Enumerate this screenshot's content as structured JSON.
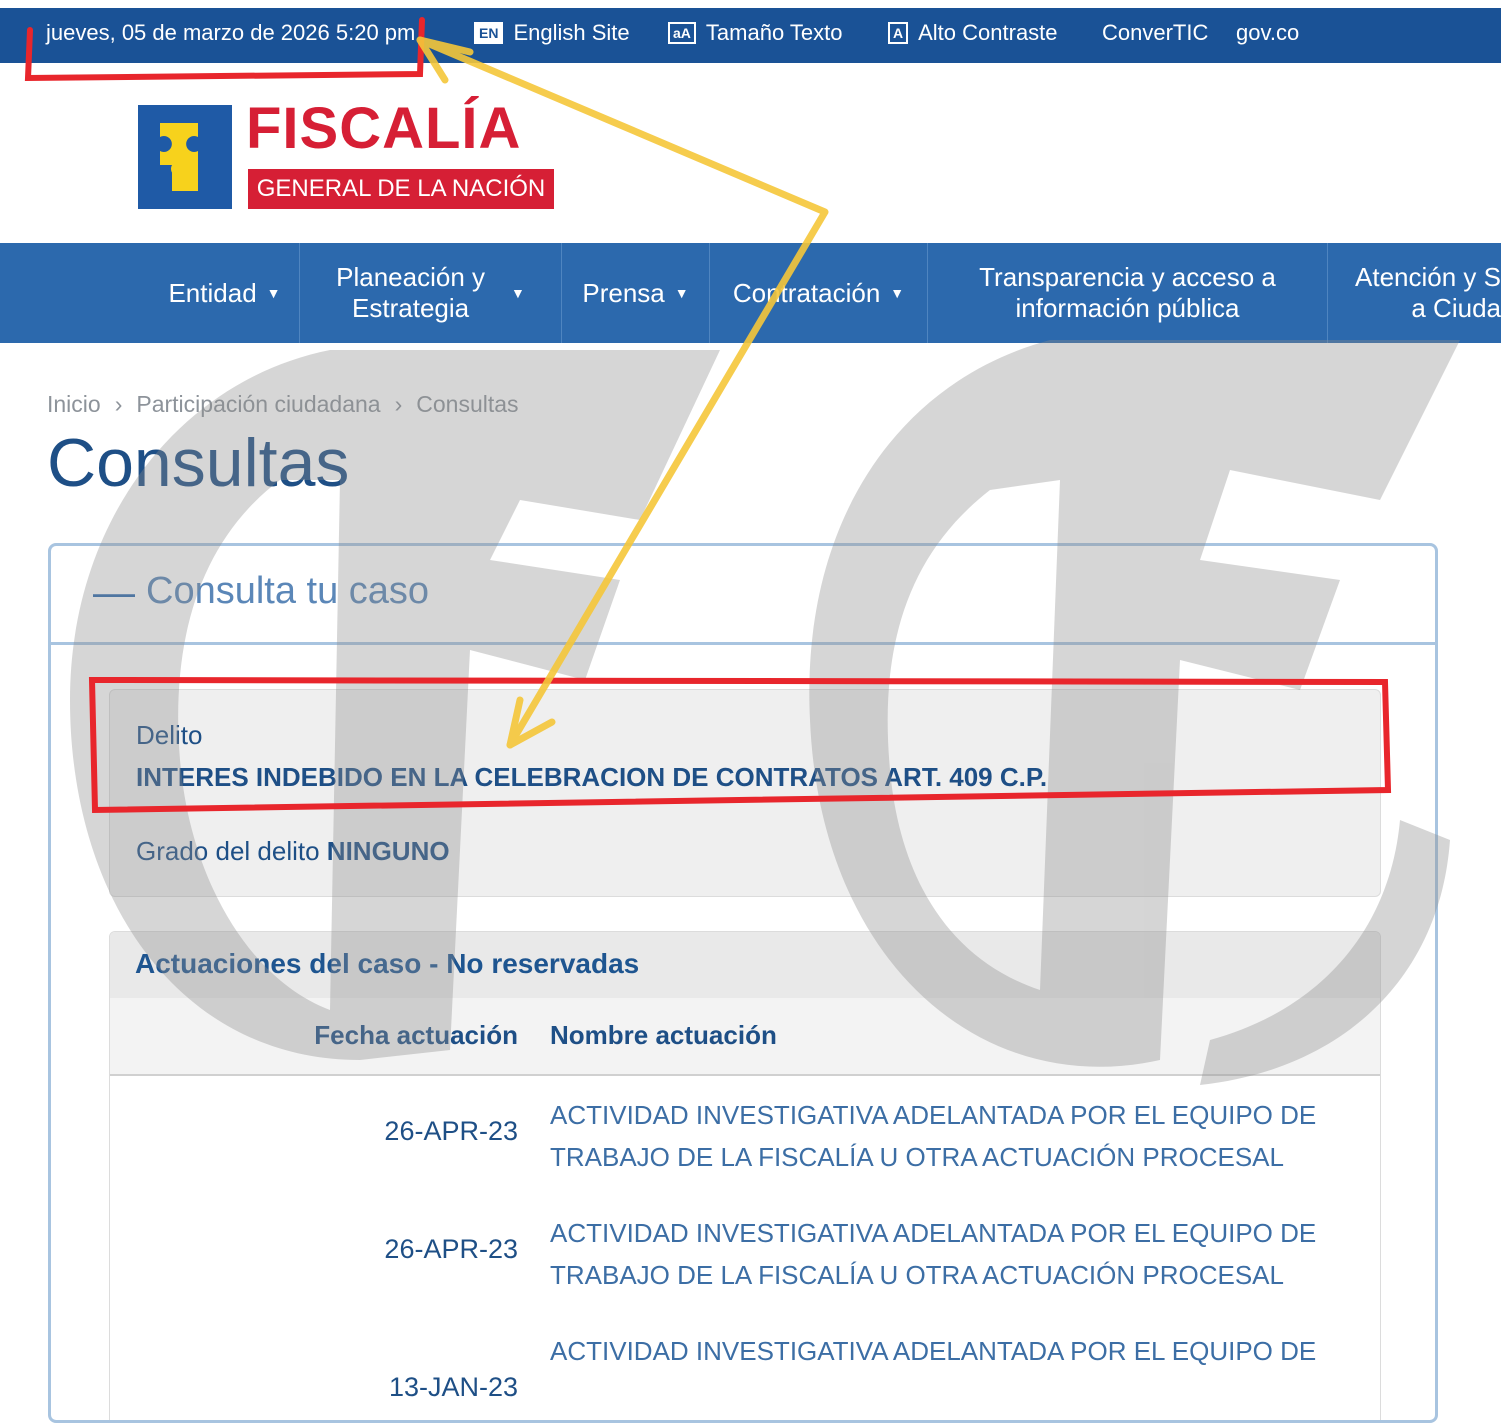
{
  "topbar": {
    "datetime": "jueves, 05 de marzo de 2026 5:20 pm",
    "english_badge": "EN",
    "english_label": "English Site",
    "text_size_badge": "aA",
    "text_size_label": "Tamaño Texto",
    "contrast_badge": "A",
    "contrast_label": "Alto Contraste",
    "convertic_label": "ConverTIC",
    "govco_label": "gov.co"
  },
  "logo": {
    "title": "FISCALÍA",
    "subtitle": "GENERAL DE LA NACIÓN"
  },
  "nav": {
    "items": [
      {
        "label": "Entidad",
        "has_dropdown": true
      },
      {
        "label_line1": "Planeación y",
        "label_line2": "Estrategia",
        "has_dropdown": true
      },
      {
        "label": "Prensa",
        "has_dropdown": true
      },
      {
        "label": "Contratación",
        "has_dropdown": true
      },
      {
        "label_line1": "Transparencia y acceso a",
        "label_line2": "información pública",
        "has_dropdown": false
      },
      {
        "label_line1": "Atención y S",
        "label_line2": "a Ciuda",
        "has_dropdown": false
      }
    ]
  },
  "breadcrumb": {
    "items": [
      "Inicio",
      "Participación ciudadana",
      "Consultas"
    ],
    "separator": "›"
  },
  "page": {
    "title": "Consultas"
  },
  "panel": {
    "toggle_symbol": "—",
    "title": "Consulta tu caso",
    "delito_label": "Delito",
    "delito_value": "INTERES INDEBIDO EN LA CELEBRACION DE CONTRATOS ART. 409 C.P.",
    "grado_label": "Grado del delito",
    "grado_value": "NINGUNO"
  },
  "actuaciones": {
    "title": "Actuaciones del caso - No reservadas",
    "columns": [
      "Fecha actuación",
      "Nombre actuación"
    ],
    "rows": [
      {
        "date": "26-APR-23",
        "name": "ACTIVIDAD INVESTIGATIVA ADELANTADA POR EL EQUIPO DE TRABAJO DE LA FISCALÍA U OTRA ACTUACIÓN PROCESAL"
      },
      {
        "date": "26-APR-23",
        "name": "ACTIVIDAD INVESTIGATIVA ADELANTADA POR EL EQUIPO DE TRABAJO DE LA FISCALÍA U OTRA ACTUACIÓN PROCESAL"
      },
      {
        "date": "13-JAN-23",
        "name": "ACTIVIDAD INVESTIGATIVA ADELANTADA POR EL EQUIPO DE"
      }
    ]
  },
  "colors": {
    "topbar": "#1a5296",
    "nav": "#2c69ad",
    "brand_red": "#d61f35",
    "title_blue": "#1e4f86",
    "annotation_red": "#e8262c",
    "annotation_yellow": "#f5c73a",
    "watermark_gray": "#9a9a9a"
  },
  "icons": {
    "puzzle": "puzzle-icon",
    "caret": "caret-down-icon",
    "watermark": "watermark-logo"
  }
}
